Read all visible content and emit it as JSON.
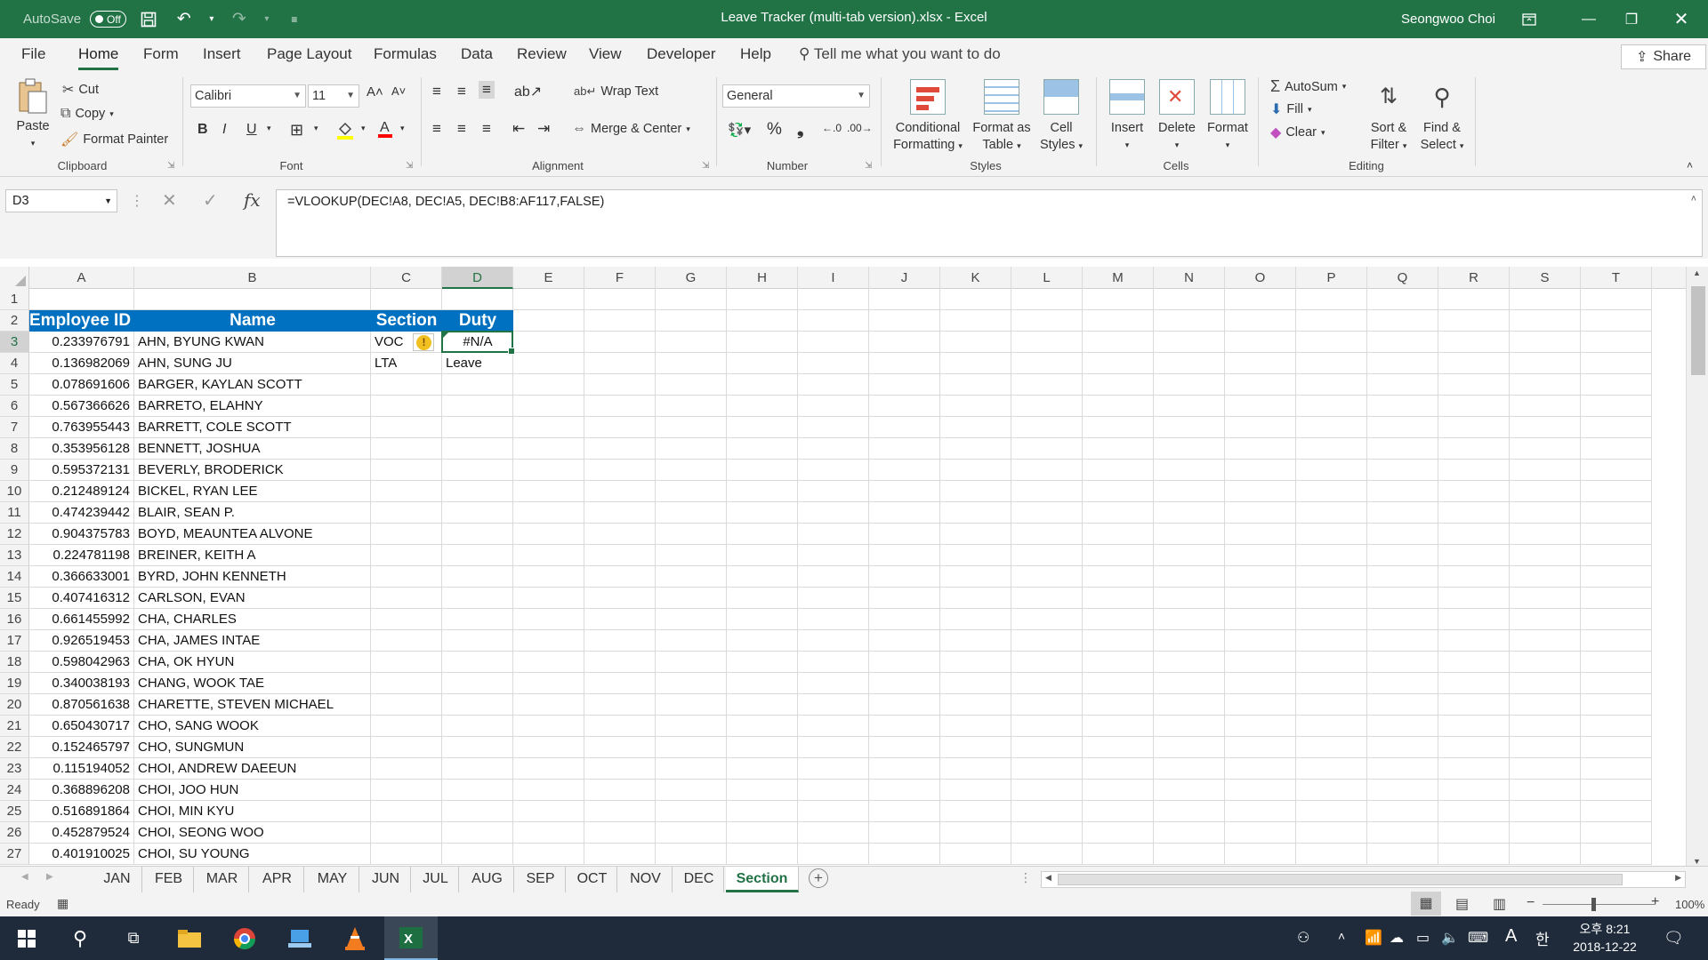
{
  "app": {
    "autosave_label": "AutoSave",
    "autosave_state": "Off",
    "doc_title": "Leave Tracker (multi-tab version).xlsx  -  Excel",
    "user_name": "Seongwoo Choi"
  },
  "menu": {
    "tabs": [
      "File",
      "Home",
      "Form",
      "Insert",
      "Page Layout",
      "Formulas",
      "Data",
      "Review",
      "View",
      "Developer",
      "Help"
    ],
    "active": "Home",
    "tell_me": "Tell me what you want to do",
    "share": "Share"
  },
  "ribbon": {
    "clipboard": {
      "label": "Clipboard",
      "paste": "Paste",
      "cut": "Cut",
      "copy": "Copy",
      "format_painter": "Format Painter"
    },
    "font": {
      "label": "Font",
      "name": "Calibri",
      "size": "11"
    },
    "alignment": {
      "label": "Alignment",
      "wrap_text": "Wrap Text",
      "merge_center": "Merge & Center"
    },
    "number": {
      "label": "Number",
      "format": "General"
    },
    "styles": {
      "label": "Styles",
      "conditional_1": "Conditional",
      "conditional_2": "Formatting",
      "format_table_1": "Format as",
      "format_table_2": "Table",
      "cell_styles_1": "Cell",
      "cell_styles_2": "Styles"
    },
    "cells": {
      "label": "Cells",
      "insert": "Insert",
      "delete": "Delete",
      "format": "Format"
    },
    "editing": {
      "label": "Editing",
      "autosum": "AutoSum",
      "fill": "Fill",
      "clear": "Clear",
      "sort_1": "Sort &",
      "sort_2": "Filter",
      "find_1": "Find &",
      "find_2": "Select"
    }
  },
  "formula_bar": {
    "name_box": "D3",
    "formula": "=VLOOKUP(DEC!A8, DEC!A5, DEC!B8:AF117,FALSE)"
  },
  "grid": {
    "columns": [
      "A",
      "B",
      "C",
      "D",
      "E",
      "F",
      "G",
      "H",
      "I",
      "J",
      "K",
      "L",
      "M",
      "N",
      "O",
      "P",
      "Q",
      "R",
      "S",
      "T"
    ],
    "selected_column": "D",
    "selected_row": "3",
    "rows": [
      "1",
      "2",
      "3",
      "4",
      "5",
      "6",
      "7",
      "8",
      "9",
      "10",
      "11",
      "12",
      "13",
      "14",
      "15",
      "16",
      "17",
      "18",
      "19",
      "20",
      "21",
      "22",
      "23",
      "24",
      "25",
      "26",
      "27"
    ],
    "headers": {
      "employee_id": "Employee ID",
      "name": "Name",
      "section": "Section",
      "duty": "Duty"
    },
    "records": [
      {
        "id": "0.233976791",
        "name": "AHN, BYUNG KWAN",
        "section": "VOC",
        "duty": "#N/A"
      },
      {
        "id": "0.136982069",
        "name": "AHN, SUNG JU",
        "section": "LTA",
        "duty": "Leave"
      },
      {
        "id": "0.078691606",
        "name": "BARGER, KAYLAN SCOTT",
        "section": "",
        "duty": ""
      },
      {
        "id": "0.567366626",
        "name": "BARRETO, ELAHNY",
        "section": "",
        "duty": ""
      },
      {
        "id": "0.763955443",
        "name": "BARRETT, COLE SCOTT",
        "section": "",
        "duty": ""
      },
      {
        "id": "0.353956128",
        "name": "BENNETT, JOSHUA",
        "section": "",
        "duty": ""
      },
      {
        "id": "0.595372131",
        "name": "BEVERLY, BRODERICK",
        "section": "",
        "duty": ""
      },
      {
        "id": "0.212489124",
        "name": "BICKEL, RYAN LEE",
        "section": "",
        "duty": ""
      },
      {
        "id": "0.474239442",
        "name": "BLAIR, SEAN P.",
        "section": "",
        "duty": ""
      },
      {
        "id": "0.904375783",
        "name": "BOYD, MEAUNTEA ALVONE",
        "section": "",
        "duty": ""
      },
      {
        "id": "0.224781198",
        "name": "BREINER, KEITH A",
        "section": "",
        "duty": ""
      },
      {
        "id": "0.366633001",
        "name": "BYRD, JOHN KENNETH",
        "section": "",
        "duty": ""
      },
      {
        "id": "0.407416312",
        "name": "CARLSON, EVAN",
        "section": "",
        "duty": ""
      },
      {
        "id": "0.661455992",
        "name": "CHA, CHARLES",
        "section": "",
        "duty": ""
      },
      {
        "id": "0.926519453",
        "name": "CHA, JAMES INTAE",
        "section": "",
        "duty": ""
      },
      {
        "id": "0.598042963",
        "name": "CHA, OK HYUN",
        "section": "",
        "duty": ""
      },
      {
        "id": "0.340038193",
        "name": "CHANG, WOOK TAE",
        "section": "",
        "duty": ""
      },
      {
        "id": "0.870561638",
        "name": "CHARETTE, STEVEN MICHAEL",
        "section": "",
        "duty": ""
      },
      {
        "id": "0.650430717",
        "name": "CHO, SANG WOOK",
        "section": "",
        "duty": ""
      },
      {
        "id": "0.152465797",
        "name": "CHO, SUNGMUN",
        "section": "",
        "duty": ""
      },
      {
        "id": "0.115194052",
        "name": "CHOI, ANDREW DAEEUN",
        "section": "",
        "duty": ""
      },
      {
        "id": "0.368896208",
        "name": "CHOI, JOO HUN",
        "section": "",
        "duty": ""
      },
      {
        "id": "0.516891864",
        "name": "CHOI, MIN KYU",
        "section": "",
        "duty": ""
      },
      {
        "id": "0.452879524",
        "name": "CHOI, SEONG WOO",
        "section": "",
        "duty": ""
      },
      {
        "id": "0.401910025",
        "name": "CHOI, SU YOUNG",
        "section": "",
        "duty": ""
      }
    ]
  },
  "sheets": {
    "tabs": [
      "JAN",
      "FEB",
      "MAR",
      "APR",
      "MAY",
      "JUN",
      "JUL",
      "AUG",
      "SEP",
      "OCT",
      "NOV",
      "DEC",
      "Section"
    ],
    "active": "Section"
  },
  "status": {
    "ready": "Ready",
    "zoom": "100%"
  },
  "taskbar": {
    "time": "오후 8:21",
    "date": "2018-12-22",
    "ime_a": "A",
    "ime_han": "한"
  },
  "colors": {
    "excel_green": "#217346",
    "header_blue": "#0070c0",
    "taskbar": "#1f2b3a"
  }
}
